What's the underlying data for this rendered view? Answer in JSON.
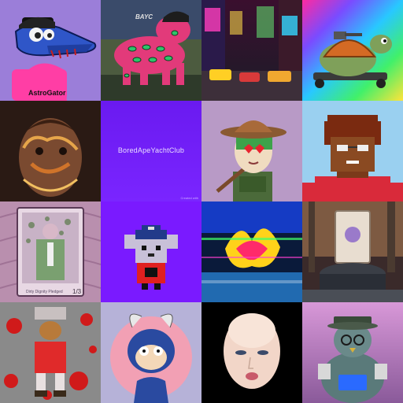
{
  "gallery": {
    "tiles": [
      {
        "subject": "blue alligator in pink shirt",
        "shirt_text": "AstroGator"
      },
      {
        "subject": "robot dog with eyes pattern",
        "hat_text": "BAYC"
      },
      {
        "subject": "neon city street at night"
      },
      {
        "subject": "turtle with cannon on skateboard"
      },
      {
        "subject": "painted portrait of a man"
      },
      {
        "subject": "collection banner",
        "label": "BoredApeYachtClub",
        "credit": "Created with"
      },
      {
        "subject": "cowgirl with heart eyes"
      },
      {
        "subject": "pixel art character with red jacket"
      },
      {
        "subject": "trading card with green suit figure",
        "card_title": "Dirty Dignity Pledged",
        "card_number": "1/3"
      },
      {
        "subject": "pixel art mouse with police cap"
      },
      {
        "subject": "glitch art flower"
      },
      {
        "subject": "framed card on stone pedestal in forest"
      },
      {
        "subject": "teddy bear figure on red splattered background"
      },
      {
        "subject": "blue monkey with horns"
      },
      {
        "subject": "bald woman face"
      },
      {
        "subject": "pigeon robot with cap and glasses"
      }
    ]
  }
}
